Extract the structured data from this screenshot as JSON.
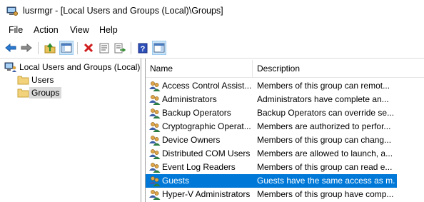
{
  "window": {
    "title": "lusrmgr - [Local Users and Groups (Local)\\Groups]"
  },
  "menu": [
    "File",
    "Action",
    "View",
    "Help"
  ],
  "toolbar": [
    "back-arrow-icon",
    "forward-arrow-icon",
    "up-folder-icon",
    "show-hide-tree-icon",
    "delete-icon",
    "properties-icon",
    "export-list-icon",
    "help-icon",
    "show-hide-action-pane-icon"
  ],
  "tree": {
    "root": "Local Users and Groups (Local)",
    "children": [
      {
        "label": "Users",
        "selected": false
      },
      {
        "label": "Groups",
        "selected": true
      }
    ]
  },
  "list": {
    "columns": [
      "Name",
      "Description"
    ],
    "rows": [
      {
        "name": "Access Control Assist...",
        "description": "Members of this group can remot...",
        "selected": false
      },
      {
        "name": "Administrators",
        "description": "Administrators have complete an...",
        "selected": false
      },
      {
        "name": "Backup Operators",
        "description": "Backup Operators can override se...",
        "selected": false
      },
      {
        "name": "Cryptographic Operat...",
        "description": "Members are authorized to perfor...",
        "selected": false
      },
      {
        "name": "Device Owners",
        "description": "Members of this group can chang...",
        "selected": false
      },
      {
        "name": "Distributed COM Users",
        "description": "Members are allowed to launch, a...",
        "selected": false
      },
      {
        "name": "Event Log Readers",
        "description": "Members of this group can read e...",
        "selected": false
      },
      {
        "name": "Guests",
        "description": "Guests have the same access as m...",
        "selected": true
      },
      {
        "name": "Hyper-V Administrators",
        "description": "Members of this group have comp...",
        "selected": false
      }
    ]
  },
  "colors": {
    "selection": "#0078d7",
    "tree_selection": "#d9d9d9",
    "toolbar_active": "#cce4f7"
  }
}
